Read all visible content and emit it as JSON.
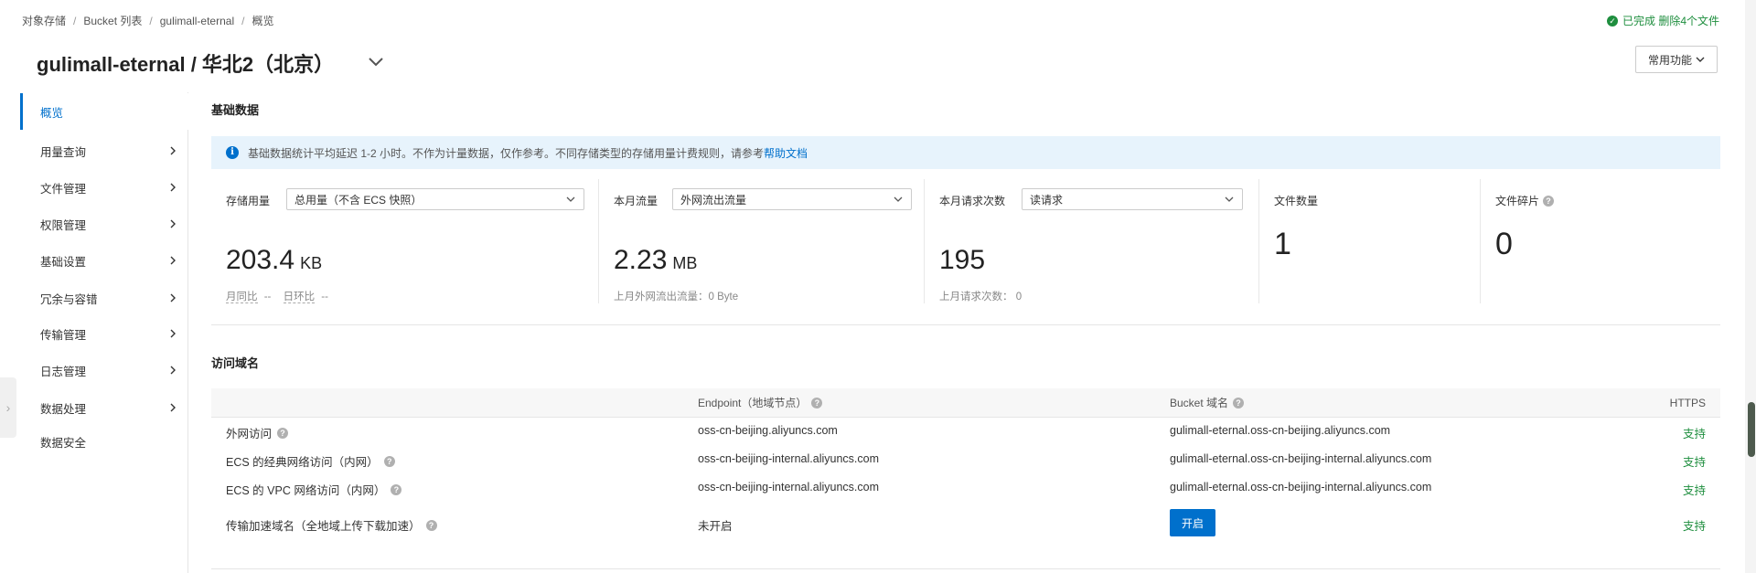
{
  "breadcrumb": [
    "对象存储",
    "Bucket 列表",
    "gulimall-eternal",
    "概览"
  ],
  "top_status": "已完成 删除4个文件",
  "page_title": "gulimall-eternal / 华北2（北京）",
  "common_button": "常用功能",
  "sidebar": {
    "items": [
      {
        "label": "概览",
        "active": true,
        "chevron": false
      },
      {
        "label": "用量查询",
        "active": false,
        "chevron": true
      },
      {
        "label": "文件管理",
        "active": false,
        "chevron": true
      },
      {
        "label": "权限管理",
        "active": false,
        "chevron": true
      },
      {
        "label": "基础设置",
        "active": false,
        "chevron": true
      },
      {
        "label": "冗余与容错",
        "active": false,
        "chevron": true
      },
      {
        "label": "传输管理",
        "active": false,
        "chevron": true
      },
      {
        "label": "日志管理",
        "active": false,
        "chevron": true
      },
      {
        "label": "数据处理",
        "active": false,
        "chevron": true
      },
      {
        "label": "数据安全",
        "active": false,
        "chevron": false
      }
    ]
  },
  "basic": {
    "title": "基础数据",
    "notice": "基础数据统计平均延迟 1-2 小时。不作为计量数据，仅作参考。不同存储类型的存储用量计费规则，请参考",
    "notice_link": "帮助文档",
    "storage": {
      "label": "存储用量",
      "select": "总用量（不含 ECS 快照）",
      "value": "203.4",
      "unit": "KB",
      "mom_label": "月同比",
      "mom_value": "--",
      "dod_label": "日环比",
      "dod_value": "--"
    },
    "traffic": {
      "label": "本月流量",
      "select": "外网流出流量",
      "value": "2.23",
      "unit": "MB",
      "sub": "上月外网流出流量：0 Byte"
    },
    "requests": {
      "label": "本月请求次数",
      "select": "读请求",
      "value": "195",
      "sub": "上月请求次数：  0"
    },
    "files": {
      "label": "文件数量",
      "value": "1"
    },
    "fragments": {
      "label": "文件碎片",
      "value": "0"
    }
  },
  "domains": {
    "title": "访问域名",
    "headers": {
      "endpoint": "Endpoint（地域节点）",
      "bucket": "Bucket 域名",
      "https": "HTTPS"
    },
    "rows": [
      {
        "name": "外网访问",
        "endpoint": "oss-cn-beijing.aliyuncs.com",
        "bucket": "gulimall-eternal.oss-cn-beijing.aliyuncs.com",
        "https": "支持"
      },
      {
        "name": "ECS 的经典网络访问（内网）",
        "endpoint": "oss-cn-beijing-internal.aliyuncs.com",
        "bucket": "gulimall-eternal.oss-cn-beijing-internal.aliyuncs.com",
        "https": "支持"
      },
      {
        "name": "ECS 的 VPC 网络访问（内网）",
        "endpoint": "oss-cn-beijing-internal.aliyuncs.com",
        "bucket": "gulimall-eternal.oss-cn-beijing-internal.aliyuncs.com",
        "https": "支持"
      },
      {
        "name": "传输加速域名（全地域上传下载加速）",
        "endpoint": "未开启",
        "button": "开启",
        "https": "支持"
      }
    ]
  },
  "colors": {
    "accent": "#0070cc",
    "success": "#1e8e3e",
    "info_bg": "#e7f3fc"
  }
}
